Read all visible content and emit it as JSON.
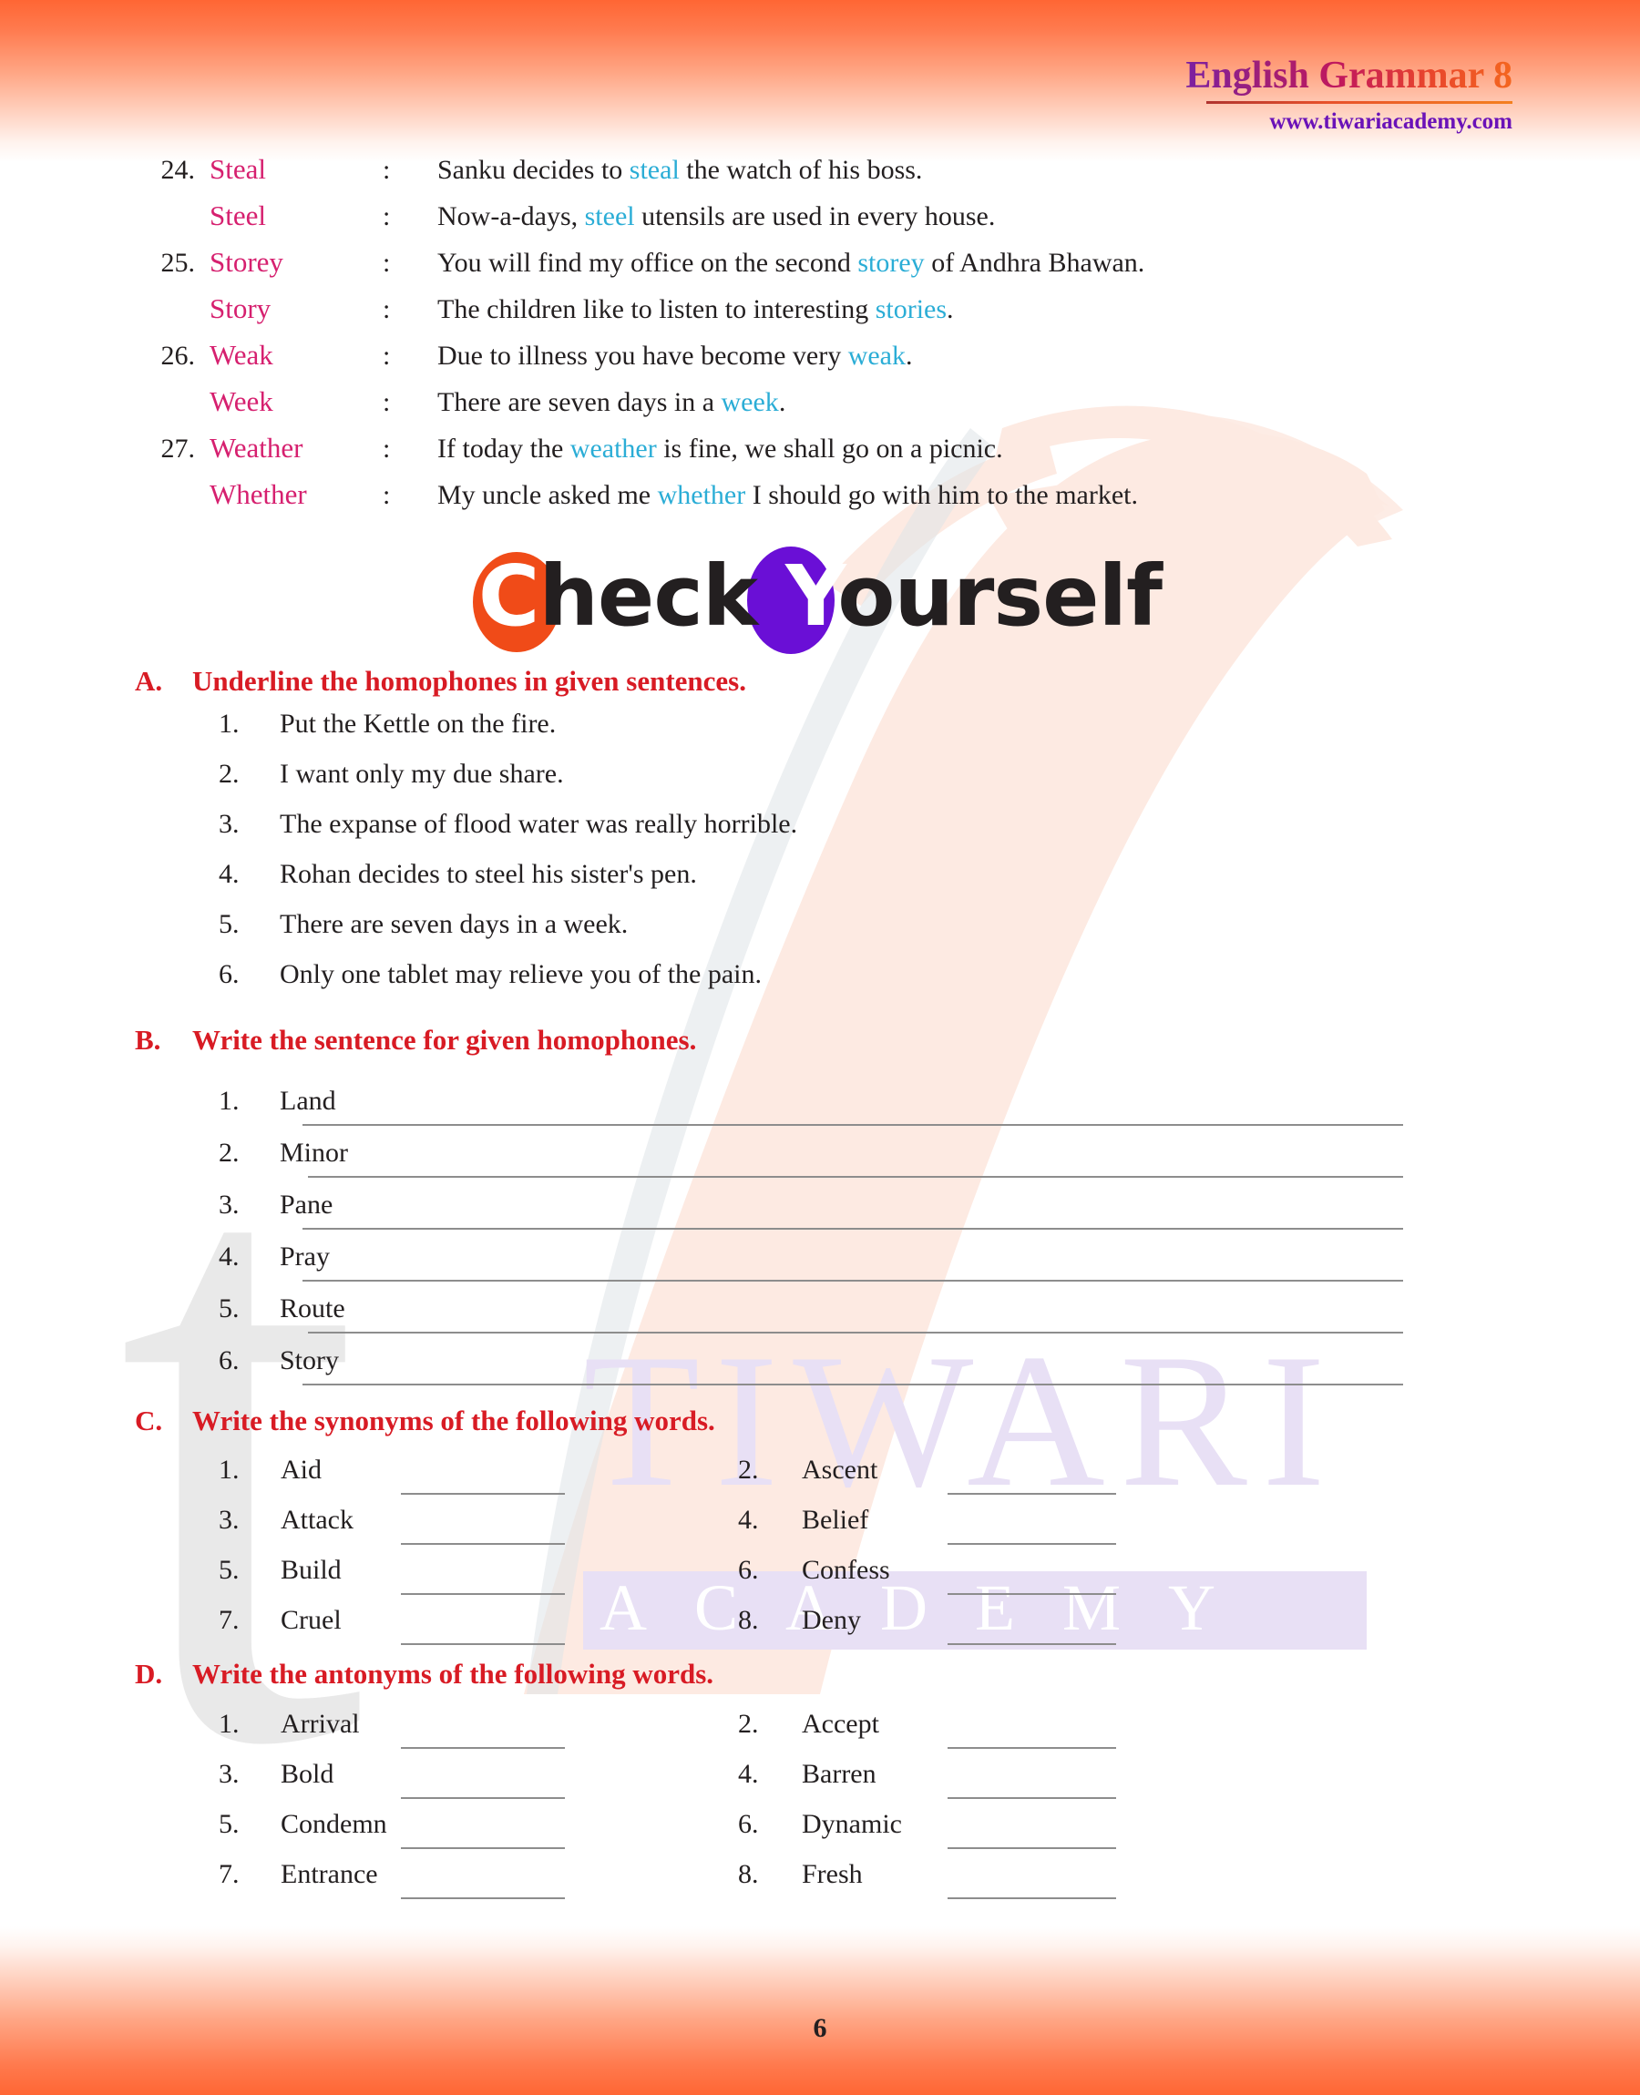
{
  "header": {
    "title": "English Grammar 8",
    "url": "www.tiwariacademy.com"
  },
  "watermark": {
    "letter": "t",
    "brand": "TIWARI",
    "sub": "ACADEMY"
  },
  "homophones": [
    {
      "num": "24.",
      "word": "Steal",
      "colon": ":",
      "before": "Sanku decides to ",
      "hl": "steal",
      "after": " the watch of his boss."
    },
    {
      "num": "",
      "word": "Steel",
      "colon": ":",
      "before": "Now-a-days, ",
      "hl": "steel",
      "after": " utensils are used in every house."
    },
    {
      "num": "25.",
      "word": "Storey",
      "colon": ":",
      "before": "You will find my office on the second ",
      "hl": "storey",
      "after": " of Andhra Bhawan."
    },
    {
      "num": "",
      "word": "Story",
      "colon": ":",
      "before": "The children like to listen to interesting ",
      "hl": "stories",
      "after": "."
    },
    {
      "num": "26.",
      "word": "Weak",
      "colon": ":",
      "before": "Due to illness you have become very ",
      "hl": "weak",
      "after": "."
    },
    {
      "num": "",
      "word": "Week",
      "colon": ":",
      "before": "There are seven days in a ",
      "hl": "week",
      "after": "."
    },
    {
      "num": "27.",
      "word": "Weather",
      "colon": ":",
      "before": "If today the ",
      "hl": "weather",
      "after": " is fine, we shall go on a picnic."
    },
    {
      "num": "",
      "word": "Whether",
      "colon": ":",
      "before": "My uncle asked me ",
      "hl": "whether",
      "after": " I should go with him to the market."
    }
  ],
  "check_yourself": {
    "c": "C",
    "heck": "heck",
    "y": "Y",
    "ourself": "ourself"
  },
  "sections": {
    "a": {
      "letter": "A.",
      "title": "Underline the homophones in given sentences.",
      "items": [
        {
          "num": "1.",
          "text": "Put the Kettle on the fire."
        },
        {
          "num": "2.",
          "text": "I want only my due share."
        },
        {
          "num": "3.",
          "text": "The expanse of flood water was really horrible."
        },
        {
          "num": "4.",
          "text": "Rohan decides to steel his sister's pen."
        },
        {
          "num": "5.",
          "text": "There are seven days in a week."
        },
        {
          "num": "6.",
          "text": "Only one tablet may relieve you of the pain."
        }
      ]
    },
    "b": {
      "letter": "B.",
      "title": "Write the sentence for given homophones.",
      "items": [
        {
          "num": "1.",
          "word": "Land"
        },
        {
          "num": "2.",
          "word": "Minor"
        },
        {
          "num": "3.",
          "word": "Pane"
        },
        {
          "num": "4.",
          "word": "Pray"
        },
        {
          "num": "5.",
          "word": "Route"
        },
        {
          "num": "6.",
          "word": "Story"
        }
      ]
    },
    "c": {
      "letter": "C.",
      "title": "Write the synonyms of the following words.",
      "items": [
        {
          "num": "1.",
          "word": "Aid"
        },
        {
          "num": "2.",
          "word": "Ascent"
        },
        {
          "num": "3.",
          "word": "Attack"
        },
        {
          "num": "4.",
          "word": "Belief"
        },
        {
          "num": "5.",
          "word": "Build"
        },
        {
          "num": "6.",
          "word": "Confess"
        },
        {
          "num": "7.",
          "word": "Cruel"
        },
        {
          "num": "8.",
          "word": "Deny"
        }
      ]
    },
    "d": {
      "letter": "D.",
      "title": "Write the antonyms of the following words.",
      "items": [
        {
          "num": "1.",
          "word": "Arrival"
        },
        {
          "num": "2.",
          "word": "Accept"
        },
        {
          "num": "3.",
          "word": "Bold"
        },
        {
          "num": "4.",
          "word": "Barren"
        },
        {
          "num": "5.",
          "word": "Condemn"
        },
        {
          "num": "6.",
          "word": "Dynamic"
        },
        {
          "num": "7.",
          "word": "Entrance"
        },
        {
          "num": "8.",
          "word": "Fresh"
        }
      ]
    }
  },
  "footer": {
    "page_number": "6"
  },
  "colors": {
    "accent_orange": "#ff6634",
    "heading_red": "#d81b24",
    "homophone_pink": "#d6206f",
    "highlight_cyan": "#2badd6",
    "title_purple": "#6a12b8",
    "swoosh_peach": "#fdeae2",
    "watermark_gray": "#e9e9e9",
    "watermark_lavender": "#e8e0f5"
  }
}
